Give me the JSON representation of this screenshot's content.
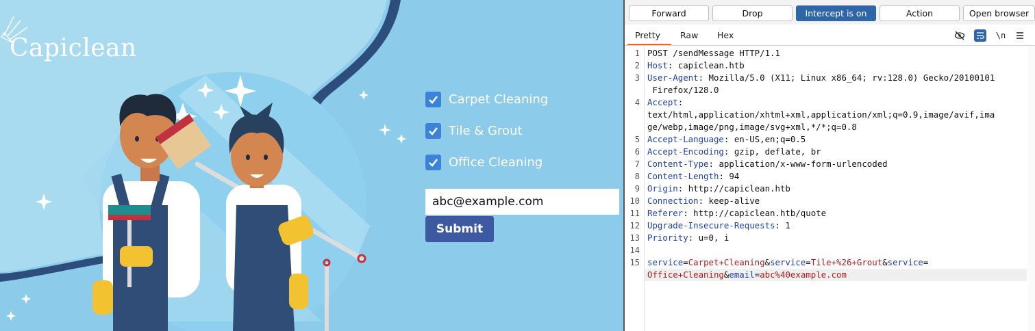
{
  "site": {
    "logo": "Capiclean",
    "services": [
      {
        "label": "Carpet Cleaning",
        "checked": true
      },
      {
        "label": "Tile & Grout",
        "checked": true
      },
      {
        "label": "Office Cleaning",
        "checked": true
      }
    ],
    "email_value": "abc@example.com",
    "submit_label": "Submit",
    "colors": {
      "background": "#8ccbea",
      "checkbox": "#3b82d9",
      "submit": "#3d59a1"
    }
  },
  "burp": {
    "toolbar": {
      "forward": "Forward",
      "drop": "Drop",
      "intercept": "Intercept is on",
      "action": "Action",
      "open_browser": "Open browser"
    },
    "tabs": {
      "pretty": "Pretty",
      "raw": "Raw",
      "hex": "Hex"
    },
    "tab_icons": [
      "eye-off-icon",
      "wrap-icon",
      "newline-icon",
      "menu-icon"
    ],
    "newline_label": "\\n",
    "line_numbers": [
      "1",
      "2",
      "3",
      "4",
      "5",
      "6",
      "7",
      "8",
      "9",
      "10",
      "11",
      "12",
      "13",
      "14",
      "15"
    ],
    "request": {
      "request_line": "POST /sendMessage HTTP/1.1",
      "headers": [
        {
          "name": "Host",
          "value": "capiclean.htb"
        },
        {
          "name": "User-Agent",
          "value": "Mozilla/5.0 (X11; Linux x86_64; rv:128.0) Gecko/20100101",
          "cont": " Firefox/128.0"
        },
        {
          "name": "Accept",
          "value": "",
          "cont1": "text/html,application/xhtml+xml,application/xml;q=0.9,image/avif,ima",
          "cont2": "ge/webp,image/png,image/svg+xml,*/*;q=0.8"
        },
        {
          "name": "Accept-Language",
          "value": "en-US,en;q=0.5"
        },
        {
          "name": "Accept-Encoding",
          "value": "gzip, deflate, br"
        },
        {
          "name": "Content-Type",
          "value": "application/x-www-form-urlencoded"
        },
        {
          "name": "Content-Length",
          "value": "94"
        },
        {
          "name": "Origin",
          "value": "http://capiclean.htb"
        },
        {
          "name": "Connection",
          "value": "keep-alive"
        },
        {
          "name": "Referer",
          "value": "http://capiclean.htb/quote"
        },
        {
          "name": "Upgrade-Insecure-Requests",
          "value": "1"
        },
        {
          "name": "Priority",
          "value": "u=0, i"
        }
      ],
      "body_params": [
        {
          "name": "service",
          "value": "Carpet+Cleaning"
        },
        {
          "name": "service",
          "value": "Tile+%26+Grout"
        },
        {
          "name": "service",
          "value": ""
        },
        {
          "name": "",
          "value": "Office+Cleaning"
        },
        {
          "name": "email",
          "value": "abc%40example.com"
        }
      ]
    },
    "colors": {
      "intercept_on": "#2f66a8",
      "header_name": "#1d3fb3",
      "param_value": "#b11d1d",
      "tab_underline": "#e8662b"
    }
  }
}
